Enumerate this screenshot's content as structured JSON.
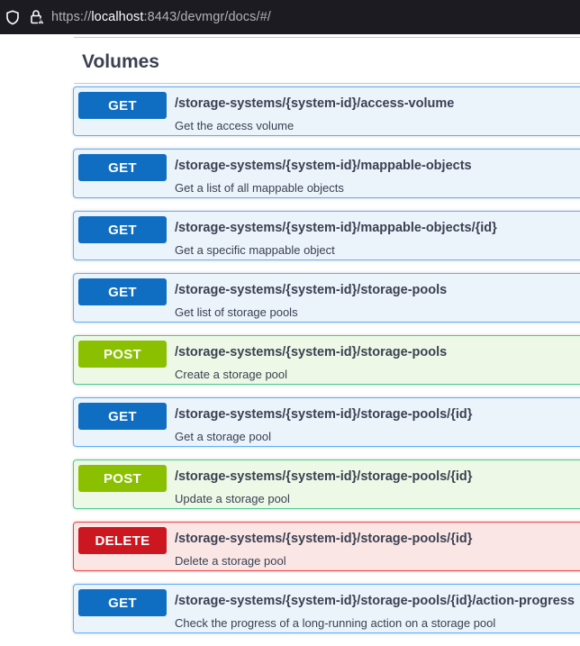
{
  "browser": {
    "url_scheme": "https://",
    "url_host": "localhost",
    "url_rest": ":8443/devmgr/docs/#/",
    "icons": [
      "shield-icon",
      "lock-icon"
    ]
  },
  "section": {
    "title": "Volumes"
  },
  "colors": {
    "get": "#0f6ec2",
    "post": "#8ac000",
    "delete": "#cc1620",
    "text": "#3b4151"
  },
  "operations": [
    {
      "method": "GET",
      "type": "get",
      "path": "/storage-systems/{system-id}/access-volume",
      "summary": "Get the access volume"
    },
    {
      "method": "GET",
      "type": "get",
      "path": "/storage-systems/{system-id}/mappable-objects",
      "summary": "Get a list of all mappable objects"
    },
    {
      "method": "GET",
      "type": "get",
      "path": "/storage-systems/{system-id}/mappable-objects/{id}",
      "summary": "Get a specific mappable object"
    },
    {
      "method": "GET",
      "type": "get",
      "path": "/storage-systems/{system-id}/storage-pools",
      "summary": "Get list of storage pools"
    },
    {
      "method": "POST",
      "type": "post",
      "path": "/storage-systems/{system-id}/storage-pools",
      "summary": "Create a storage pool"
    },
    {
      "method": "GET",
      "type": "get",
      "path": "/storage-systems/{system-id}/storage-pools/{id}",
      "summary": "Get a storage pool"
    },
    {
      "method": "POST",
      "type": "post",
      "path": "/storage-systems/{system-id}/storage-pools/{id}",
      "summary": "Update a storage pool"
    },
    {
      "method": "DELETE",
      "type": "delete",
      "path": "/storage-systems/{system-id}/storage-pools/{id}",
      "summary": "Delete a storage pool"
    },
    {
      "method": "GET",
      "type": "get",
      "path": "/storage-systems/{system-id}/storage-pools/{id}/action-progress",
      "summary": "Check the progress of a long-running action on a storage pool"
    }
  ]
}
